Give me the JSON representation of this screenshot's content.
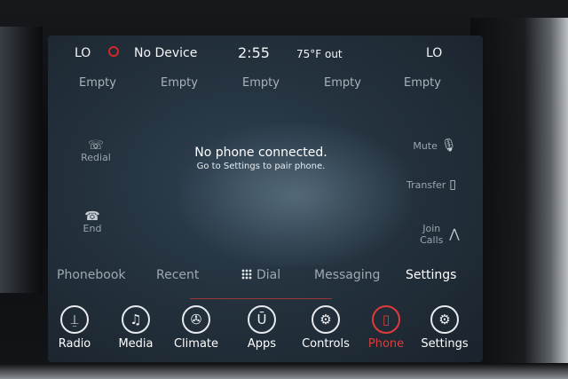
{
  "status": {
    "left_temp": "LO",
    "bluetooth_icon": "bluetooth-icon",
    "device": "No Device",
    "time": "2:55",
    "outside_temp": "75°F out",
    "right_temp": "LO",
    "accent_color": "#d3282a"
  },
  "favorites": [
    "Empty",
    "Empty",
    "Empty",
    "Empty",
    "Empty"
  ],
  "phone": {
    "redial": "Redial",
    "end": "End",
    "mute": "Mute",
    "transfer": "Transfer",
    "join_calls": "Join Calls",
    "message_title": "No phone connected.",
    "message_sub": "Go to Settings to pair phone."
  },
  "tabs": {
    "phonebook": "Phonebook",
    "recent": "Recent",
    "dial": "Dial",
    "messaging": "Messaging",
    "settings": "Settings"
  },
  "dock": {
    "radio": "Radio",
    "media": "Media",
    "climate": "Climate",
    "apps": "Apps",
    "controls": "Controls",
    "phone": "Phone",
    "settings": "Settings",
    "active": "Phone"
  }
}
